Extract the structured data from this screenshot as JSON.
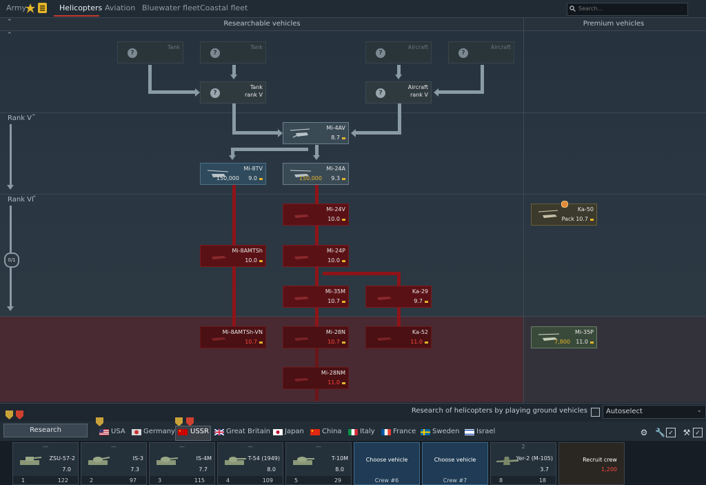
{
  "topbar": {
    "army_label": "Army",
    "tabs": [
      "Helicopters",
      "Aviation",
      "Bluewater fleet",
      "Coastal fleet"
    ],
    "search_placeholder": "Search..."
  },
  "header": {
    "researchable_title": "Researchable vehicles",
    "premium_title": "Premium vehicles"
  },
  "ranks": {
    "rank5": "Rank V",
    "rank6": "Rank VI",
    "progress": "0/1"
  },
  "tree": {
    "unknown_top": [
      {
        "type": "Tank"
      },
      {
        "type": "Tank"
      },
      {
        "type": "Aircraft"
      },
      {
        "type": "Aircraft"
      }
    ],
    "req_tank": {
      "name": "Tank",
      "rank": "rank V"
    },
    "req_aircraft": {
      "name": "Aircraft",
      "rank": "rank V"
    },
    "mi4av": {
      "name": "Mi-4AV",
      "br": "8.7"
    },
    "mi8tv": {
      "name": "Mi-8TV",
      "cost": "150,000",
      "br": "9.0"
    },
    "mi24a": {
      "name": "Mi-24A",
      "cost": "150,000",
      "br": "9.3"
    },
    "mi24v": {
      "name": "Mi-24V",
      "br": "10.0"
    },
    "mi8amtsh": {
      "name": "Mi-8AMTSh",
      "br": "10.0"
    },
    "mi24p": {
      "name": "Mi-24P",
      "br": "10.0"
    },
    "mi35m": {
      "name": "Mi-35M",
      "br": "10.7"
    },
    "ka29": {
      "name": "Ka-29",
      "br": "9.7"
    },
    "mi8amtshvn": {
      "name": "Mi-8AMTSh-VN",
      "br": "10.7"
    },
    "mi28n": {
      "name": "Mi-28N",
      "br": "10.7"
    },
    "ka52": {
      "name": "Ka-52",
      "br": "11.0"
    },
    "mi28nm": {
      "name": "Mi-28NM",
      "br": "11.0"
    },
    "ka50": {
      "name": "Ka-50",
      "pack": "Pack",
      "br": "10.7"
    },
    "mi35p": {
      "name": "Mi-35P",
      "cost": "7,800",
      "br": "11.0"
    }
  },
  "bottom": {
    "research_note": "Research of helicopters by playing ground vehicles",
    "autoselect": "Autoselect",
    "research_button": "Research",
    "nations": [
      "USA",
      "Germany",
      "USSR",
      "Great Britain",
      "Japan",
      "China",
      "Italy",
      "France",
      "Sweden",
      "Israel"
    ]
  },
  "crew": {
    "slots": [
      {
        "dash": "—",
        "name": "ZSU-57-2",
        "br": "7.0",
        "rank": "1",
        "rp": "122"
      },
      {
        "dash": "—",
        "name": "IS-3",
        "br": "7.3",
        "rank": "2",
        "rp": "97"
      },
      {
        "dash": "—",
        "name": "IS-4M",
        "br": "7.7",
        "rank": "3",
        "rp": "115"
      },
      {
        "dash": "—",
        "name": "T-54 (1949)",
        "br": "8.0",
        "rank": "4",
        "rp": "109"
      },
      {
        "dash": "—",
        "name": "T-10M",
        "br": "8.0",
        "rank": "5",
        "rp": "29"
      }
    ],
    "choose_vehicle": "Choose vehicle",
    "crew6": "Crew #6",
    "crew7": "Crew #7",
    "yer2": {
      "dash": "2",
      "name": "Yer-2 (M-105)",
      "br": "3.7",
      "rank": "8",
      "rp": "18"
    },
    "recruit": "Recruit crew",
    "recruit_cost": "1,200"
  },
  "colors": {
    "accent_red": "#c23a2e",
    "gold": "#e3b52a",
    "locked_red": "#5a1115",
    "br_red": "#ff4a3f"
  }
}
